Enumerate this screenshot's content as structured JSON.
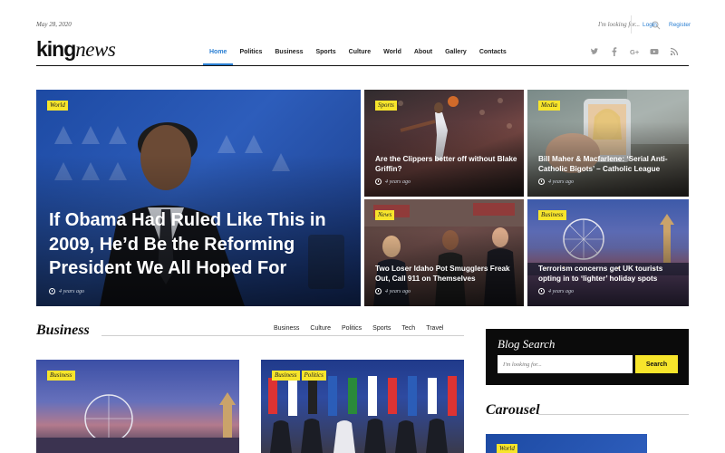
{
  "topbar": {
    "date": "May 28, 2020",
    "search_placeholder": "I'm looking for...",
    "login": "Login",
    "register": "Register"
  },
  "logo": {
    "bold": "king",
    "italic": "news"
  },
  "nav": {
    "items": [
      "Home",
      "Politics",
      "Business",
      "Sports",
      "Culture",
      "World",
      "About",
      "Gallery",
      "Contacts"
    ],
    "active": "Home"
  },
  "social": [
    "twitter-icon",
    "facebook-icon",
    "google-plus-icon",
    "youtube-icon",
    "rss-icon"
  ],
  "hero": {
    "main": {
      "category": "World",
      "title": "If Obama Had Ruled Like This in 2009, He’d Be the Reforming President We All Hoped For",
      "time": "4 years ago"
    },
    "tiles": [
      {
        "category": "Sports",
        "title": "Are the Clippers better off without Blake Griffin?",
        "time": "4 years ago"
      },
      {
        "category": "Media",
        "title": "Bill Maher & Macfarlene: ‘Serial Anti-Catholic Bigots’ – Catholic League",
        "time": "4 years ago"
      },
      {
        "category": "News",
        "title": "Two Loser Idaho Pot Smugglers Freak Out, Call 911 on Themselves",
        "time": "4 years ago"
      },
      {
        "category": "Business",
        "title": "Terrorism concerns get UK tourists opting in to ‘lighter’ holiday spots",
        "time": "4 years ago"
      }
    ]
  },
  "business": {
    "title": "Business",
    "tabs": [
      "Business",
      "Culture",
      "Politics",
      "Sports",
      "Tech",
      "Travel"
    ],
    "cards": [
      {
        "badges": [
          "Business"
        ]
      },
      {
        "badges": [
          "Business",
          "Politics"
        ]
      }
    ]
  },
  "sidebar": {
    "blog_search": {
      "title": "Blog Search",
      "placeholder": "I'm looking for...",
      "button": "Search"
    },
    "carousel": {
      "title": "Carousel",
      "badge": "World"
    }
  },
  "colors": {
    "accent": "#2a7fd3",
    "badge": "#f7e52b",
    "dark": "#0b0b0b"
  }
}
